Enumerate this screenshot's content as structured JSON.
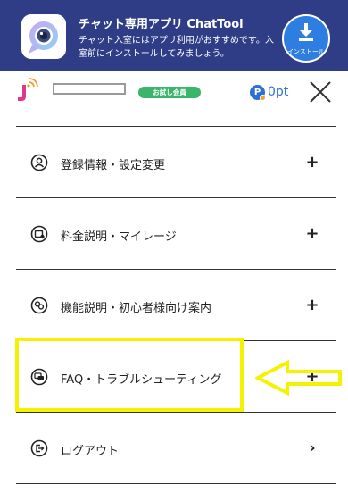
{
  "banner": {
    "title": "チャット専用アプリ ChatTool",
    "description": "チャット入室にはアプリ利用がおすすめです。入室前にインストールしてみましょう。",
    "install_label": "インストール"
  },
  "header": {
    "member_badge": "お試し会員",
    "points": "0pt",
    "points_icon_letter": "P"
  },
  "menu": {
    "items": [
      {
        "label": "登録情報・設定変更",
        "icon": "user-icon",
        "action": "+"
      },
      {
        "label": "料金説明・マイレージ",
        "icon": "wallet-icon",
        "action": "+"
      },
      {
        "label": "機能説明・初心者様向け案内",
        "icon": "link-icon",
        "action": "+"
      },
      {
        "label": "FAQ・トラブルシューティング",
        "icon": "faq-icon",
        "action": "+"
      },
      {
        "label": "ログアウト",
        "icon": "logout-icon",
        "action": "›"
      }
    ]
  },
  "colors": {
    "banner_bg": "#2f3d86",
    "install_bg": "#2e7de1",
    "badge_green": "#3bb56a",
    "points_blue": "#2d6fd6",
    "highlight_yellow": "#f5f200",
    "logo_pink": "#e0368b",
    "logo_orange": "#f0a030"
  }
}
